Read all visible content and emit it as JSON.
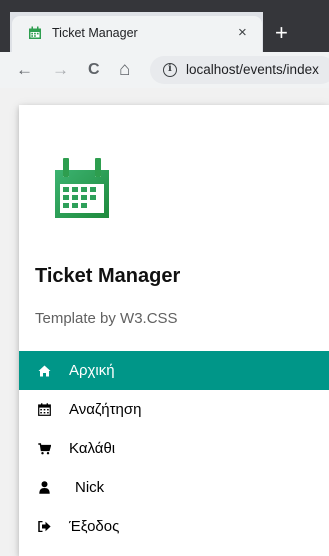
{
  "browser": {
    "tab_title": "Ticket Manager",
    "close_glyph": "×",
    "new_tab_glyph": "+",
    "back_glyph": "←",
    "forward_glyph": "→",
    "reload_glyph": "C",
    "home_glyph": "⌂",
    "url": "localhost/events/index"
  },
  "sidebar": {
    "logo_icon": "calendar-icon",
    "title": "Ticket Manager",
    "subtitle": "Template by W3.CSS",
    "items": [
      {
        "label": "Αρχική",
        "icon": "home-icon",
        "active": true
      },
      {
        "label": "Αναζήτηση",
        "icon": "calendar-icon",
        "active": false
      },
      {
        "label": "Καλάθι",
        "icon": "cart-icon",
        "active": false
      },
      {
        "label": "Nick",
        "icon": "user-icon",
        "active": false
      },
      {
        "label": "Έξοδος",
        "icon": "sign-out-icon",
        "active": false
      }
    ]
  },
  "colors": {
    "accent": "#009688",
    "logo_green": "#2e9e4f",
    "chrome_dark": "#35363a"
  }
}
